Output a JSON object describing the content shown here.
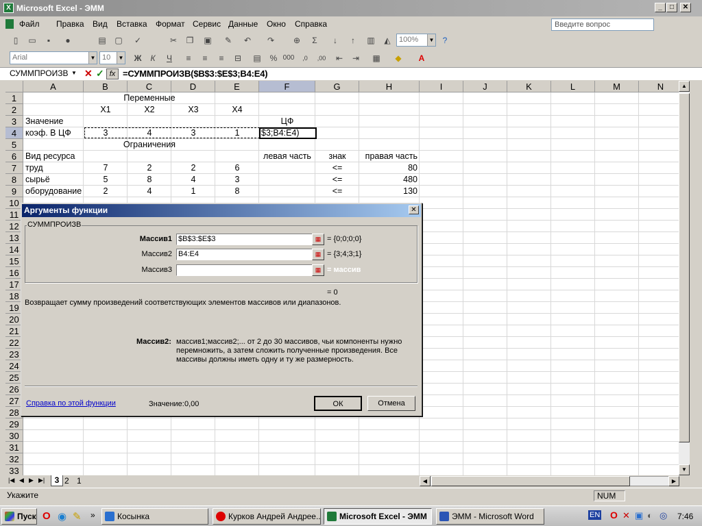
{
  "window": {
    "title": "Microsoft Excel - ЭММ",
    "minimize": "_",
    "maximize": "□",
    "close": "✕"
  },
  "menu": {
    "items": [
      "Файл",
      "Правка",
      "Вид",
      "Вставка",
      "Формат",
      "Сервис",
      "Данные",
      "Окно",
      "Справка"
    ],
    "ask_placeholder": "Введите вопрос"
  },
  "toolbar": {
    "zoom": "100%",
    "font": "Arial",
    "size": "10",
    "bold": "Ж",
    "italic": "К",
    "underline": "Ч"
  },
  "formula_bar": {
    "name_box": "СУММПРОИЗВ",
    "formula": "=СУММПРОИЗВ($B$3:$E$3;B4:E4)"
  },
  "columns": [
    "A",
    "B",
    "C",
    "D",
    "E",
    "F",
    "G",
    "H",
    "I",
    "J",
    "K",
    "L",
    "M",
    "N"
  ],
  "rows": [
    "1",
    "2",
    "3",
    "4",
    "5",
    "6",
    "7",
    "8",
    "9",
    "10",
    "11",
    "12",
    "13",
    "14",
    "15",
    "16",
    "17",
    "18",
    "19",
    "20",
    "21",
    "22",
    "23",
    "24",
    "25",
    "26",
    "27",
    "28",
    "29",
    "30",
    "31",
    "32",
    "33"
  ],
  "cells": {
    "C1": "Переменные",
    "B2": "X1",
    "C2": "X2",
    "D2": "X3",
    "E2": "X4",
    "A3": "Значение",
    "F3": "ЦФ",
    "A4": "коэф. В ЦФ",
    "B4": "3",
    "C4": "4",
    "D4": "3",
    "E4": "1",
    "F4": "$3;B4:E4)",
    "C5": "Ограничения",
    "A6": "Вид ресурса",
    "F6": "левая часть",
    "G6": "знак",
    "H6": "правая часть",
    "A7": "труд",
    "B7": "7",
    "C7": "2",
    "D7": "2",
    "E7": "6",
    "G7": "<=",
    "H7": "80",
    "A8": "сырьё",
    "B8": "5",
    "C8": "8",
    "D8": "4",
    "E8": "3",
    "G8": "<=",
    "H8": "480",
    "A9": "оборудование",
    "B9": "2",
    "C9": "4",
    "D9": "1",
    "E9": "8",
    "G9": "<=",
    "H9": "130"
  },
  "sheet_tabs": [
    "3",
    "2",
    "1"
  ],
  "status": {
    "left": "Укажите",
    "num": "NUM"
  },
  "dialog": {
    "title": "Аргументы функции",
    "function_name": "СУММПРОИЗВ",
    "args": [
      {
        "label": "Массив1",
        "value": "$B$3:$E$3",
        "result": "= {0;0;0;0}"
      },
      {
        "label": "Массив2",
        "value": "B4:E4",
        "result": "= {3;4;3;1}"
      },
      {
        "label": "Массив3",
        "value": "",
        "result": "= массив"
      }
    ],
    "total": "= 0",
    "description": "Возвращает сумму произведений соответствующих элементов массивов или диапазонов.",
    "help_arg_label": "Массив2:",
    "help_arg_text": "массив1;массив2;... от 2 до 30 массивов, чьи компоненты нужно перемножить, а затем сложить полученные произведения. Все массивы должны иметь одну и ту же размерность.",
    "help_link": "Справка по этой функции",
    "value_label": "Значение:",
    "value": "0,00",
    "ok": "ОК",
    "cancel": "Отмена"
  },
  "taskbar": {
    "start": "Пуск",
    "tasks": [
      "Косынка",
      "Курков Андрей Андрее...",
      "Microsoft Excel - ЭММ",
      "ЭММ - Microsoft Word"
    ],
    "lang": "EN",
    "clock": "7:46"
  }
}
